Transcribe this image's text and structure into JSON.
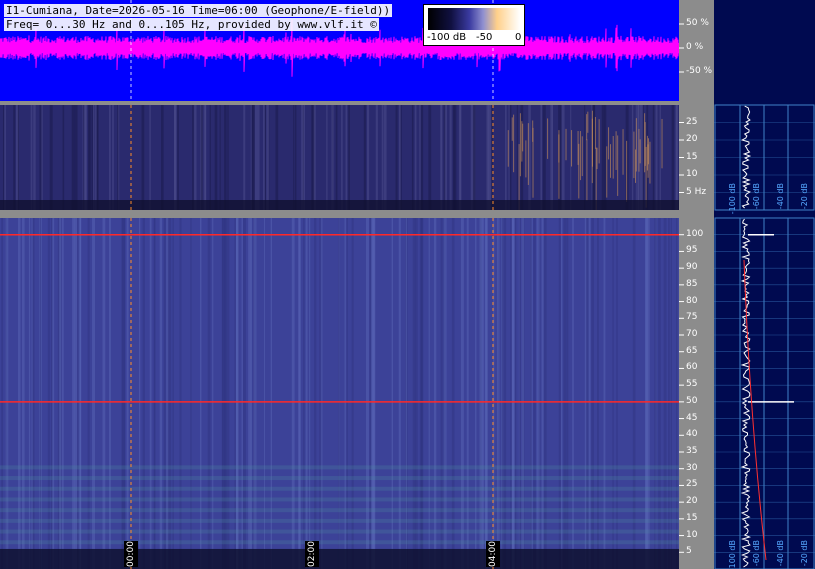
{
  "header": {
    "title_line1": "I1-Cumiana, Date=2026-05-16 Time=06:00 (Geophone/E-field))",
    "title_line2": "Freq= 0...30 Hz and 0...105 Hz, provided by www.vlf.it ©"
  },
  "colorbar": {
    "labels": [
      "-100 dB",
      "-50",
      "0"
    ]
  },
  "colors": {
    "wave_bg": "#0000ff",
    "wave_trace": "#ff00ff",
    "axis_bg": "#8c8c8c",
    "panel_bg": "#000a50",
    "grid": "#3f82c8",
    "marker_line": "#ff8c28",
    "hum_line": "#ff2828"
  },
  "chart_data": [
    {
      "type": "area",
      "panel": "waveform",
      "y_ticks": [
        "50 %",
        "0 %",
        "-50 %"
      ],
      "ylim": [
        -100,
        100
      ]
    },
    {
      "type": "heatmap",
      "panel": "spectrogram-low",
      "ylim": [
        0,
        30
      ],
      "y_ticks": [
        "25",
        "20",
        "15",
        "10",
        "5 Hz"
      ],
      "y_tick_values": [
        25,
        20,
        15,
        10,
        5
      ],
      "band_power_labels": [
        "-100 dB",
        "-60 dB",
        "-40 dB",
        "-20 dB"
      ]
    },
    {
      "type": "heatmap",
      "panel": "spectrogram-high",
      "ylim": [
        0,
        105
      ],
      "y_ticks": [
        "100",
        "95",
        "90",
        "85",
        "80",
        "75",
        "70",
        "65",
        "60",
        "55",
        "50",
        "45",
        "40",
        "35",
        "30",
        "25",
        "20",
        "15",
        "10",
        "5"
      ],
      "y_tick_values": [
        100,
        95,
        90,
        85,
        80,
        75,
        70,
        65,
        60,
        55,
        50,
        45,
        40,
        35,
        30,
        25,
        20,
        15,
        10,
        5
      ],
      "band_power_labels": [
        "-100 dB",
        "-60 dB",
        "-40 dB",
        "-20 dB"
      ],
      "time_labels": [
        "00:00",
        "02:00",
        "04:00"
      ],
      "time_hours": [
        0,
        2,
        4
      ],
      "hum_lines_hz": [
        50,
        100
      ]
    }
  ]
}
